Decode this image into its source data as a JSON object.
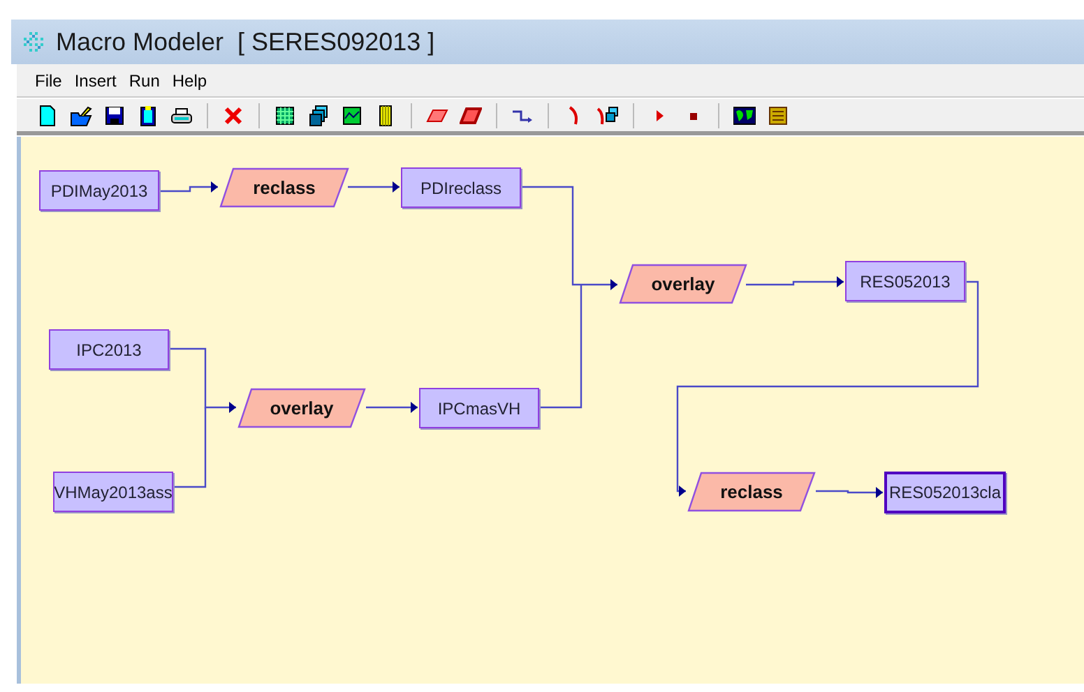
{
  "window": {
    "title": "Macro Modeler  [ SERES092013 ]"
  },
  "menu": [
    "File",
    "Insert",
    "Run",
    "Help"
  ],
  "nodes": [
    {
      "kind": "data",
      "label": "PDIMay2013",
      "selected": false
    },
    {
      "kind": "module",
      "label": "reclass",
      "selected": false
    },
    {
      "kind": "data",
      "label": "PDIreclass",
      "selected": false
    },
    {
      "kind": "data",
      "label": "IPC2013",
      "selected": false
    },
    {
      "kind": "module",
      "label": "overlay",
      "selected": false
    },
    {
      "kind": "data",
      "label": "IPCmasVH",
      "selected": false
    },
    {
      "kind": "data",
      "label": "VHMay2013ass",
      "selected": false
    },
    {
      "kind": "module",
      "label": "overlay",
      "selected": false
    },
    {
      "kind": "data",
      "label": "RES052013",
      "selected": false
    },
    {
      "kind": "module",
      "label": "reclass",
      "selected": false
    },
    {
      "kind": "data",
      "label": "RES052013cla",
      "selected": true
    }
  ]
}
